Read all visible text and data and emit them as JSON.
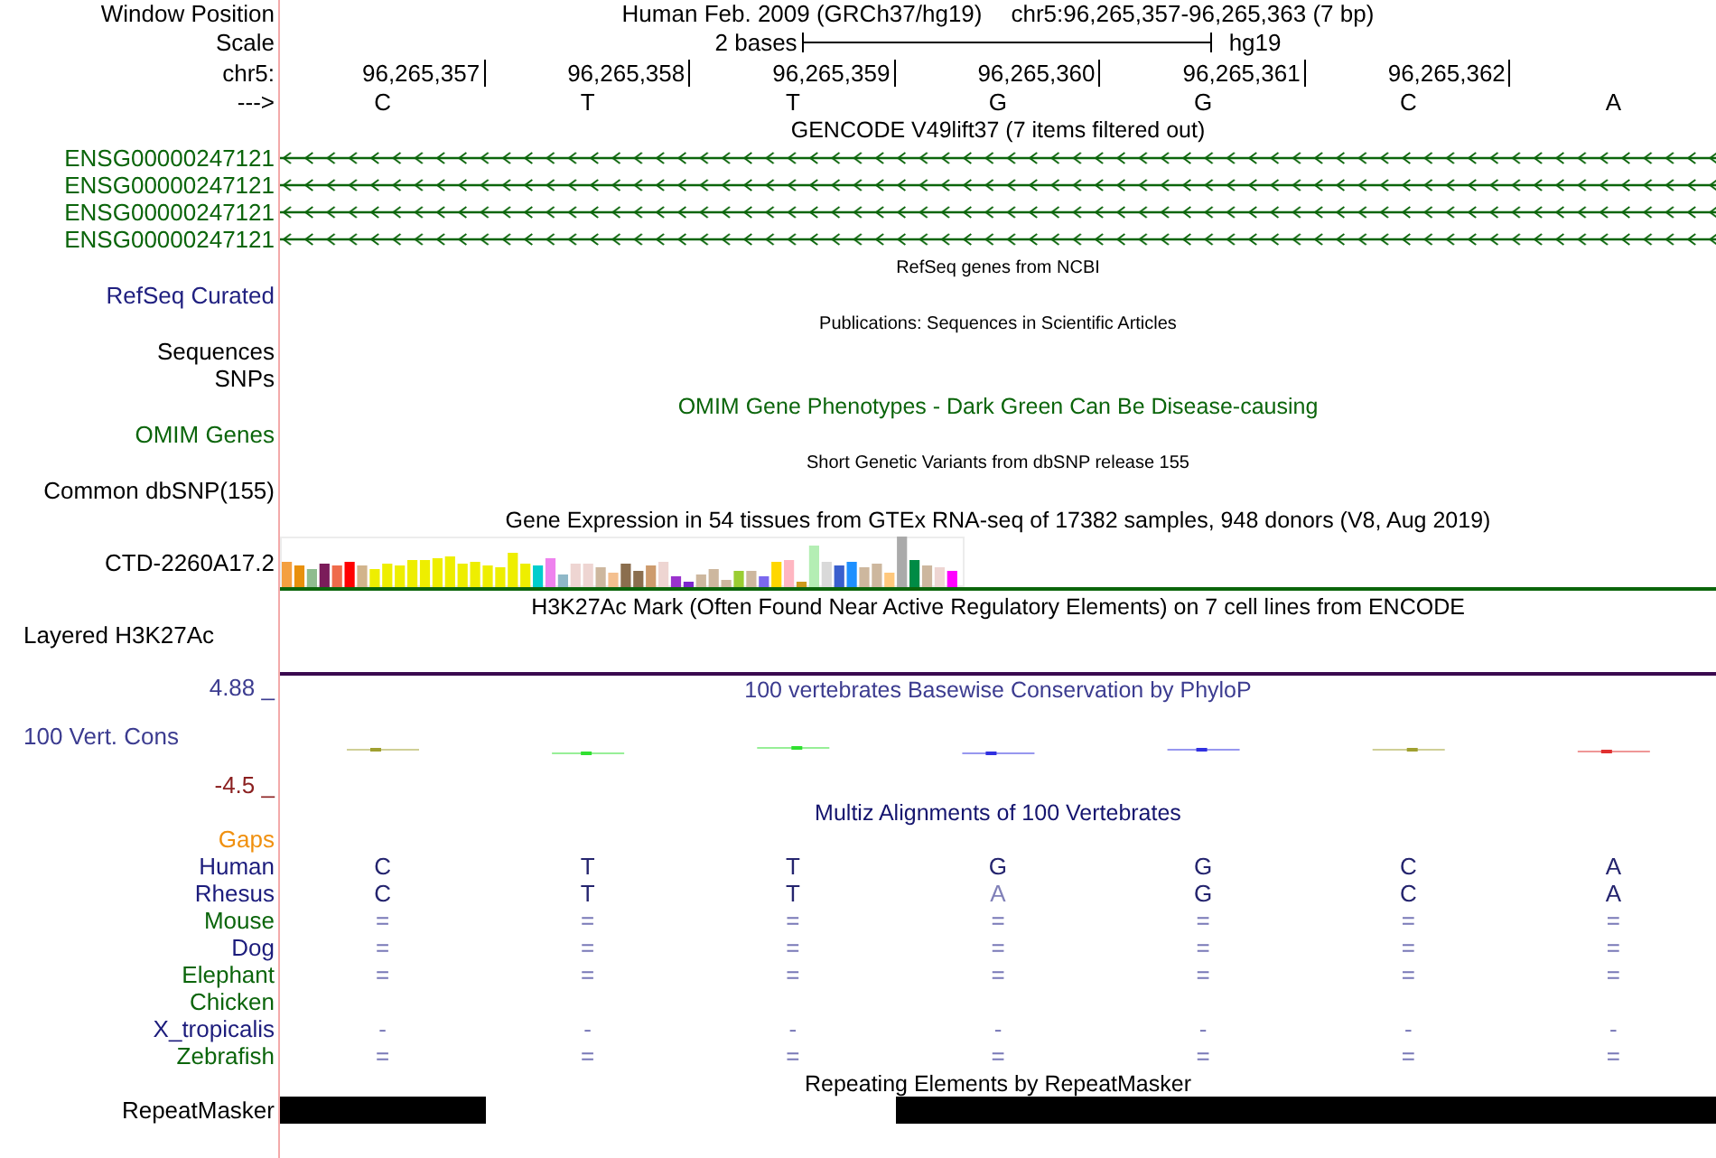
{
  "header": {
    "label": "Window Position",
    "assembly": "Human Feb. 2009 (GRCh37/hg19)",
    "position": "chr5:96,265,357-96,265,363 (7 bp)"
  },
  "scale": {
    "label": "Scale",
    "span": "2 bases",
    "assembly": "hg19"
  },
  "ruler": {
    "label": "chr5:",
    "positions": [
      "96,265,357",
      "96,265,358",
      "96,265,359",
      "96,265,360",
      "96,265,361",
      "96,265,362"
    ]
  },
  "sequence": {
    "label": "--->",
    "bases": [
      "C",
      "T",
      "T",
      "G",
      "G",
      "C",
      "A"
    ]
  },
  "tracks": [
    {
      "kind": "genes",
      "title": "GENCODE V49lift37 (7 items filtered out)",
      "color": "#000000",
      "items": [
        {
          "label": "ENSG00000247121"
        },
        {
          "label": "ENSG00000247121"
        },
        {
          "label": "ENSG00000247121"
        },
        {
          "label": "ENSG00000247121"
        }
      ]
    },
    {
      "kind": "dense",
      "title": "RefSeq genes from NCBI",
      "color": "#000000",
      "labels": [
        {
          "text": "RefSeq Curated",
          "color": "#202080"
        }
      ]
    },
    {
      "kind": "dense",
      "title": "Publications: Sequences in Scientific Articles",
      "color": "#000000",
      "labels": [
        {
          "text": "Sequences",
          "color": "#000000"
        },
        {
          "text": "SNPs",
          "color": "#000000"
        }
      ]
    },
    {
      "kind": "full",
      "title": "OMIM Gene Phenotypes - Dark Green Can Be Disease-causing",
      "color": "#0b650b",
      "labels": [
        {
          "text": "OMIM Genes",
          "color": "#0b650b"
        }
      ]
    },
    {
      "kind": "dense",
      "title": "Short Genetic Variants from dbSNP release 155",
      "color": "#000000",
      "labels": [
        {
          "text": "Common dbSNP(155)",
          "color": "#000000"
        }
      ]
    },
    {
      "kind": "barchart",
      "title": "Gene Expression in 54 tissues from GTEx RNA-seq of 17382 samples, 948 donors (V8, Aug 2019)",
      "color": "#000000",
      "label": "CTD-2260A17.2"
    },
    {
      "kind": "layered",
      "title": "H3K27Ac Mark (Often Found Near Active Regulatory Elements) on 7 cell lines from ENCODE",
      "color": "#000000",
      "label": "Layered H3K27Ac"
    },
    {
      "kind": "wiggle",
      "title": "100 vertebrates Basewise Conservation by PhyloP",
      "color": "#3c3c90",
      "label": "100 Vert. Cons",
      "max": "4.88 _",
      "min": "-4.5 _"
    },
    {
      "kind": "alignment",
      "title": "Multiz Alignments of 100 Vertebrates",
      "color": "#14146e",
      "rows": [
        {
          "label": "Gaps",
          "color": "#f0900f"
        },
        {
          "label": "Human",
          "color": "#1c1c7c",
          "bases": [
            {
              "b": "C",
              "match": true
            },
            {
              "b": "T",
              "match": true
            },
            {
              "b": "T",
              "match": true
            },
            {
              "b": "G",
              "match": true
            },
            {
              "b": "G",
              "match": true
            },
            {
              "b": "C",
              "match": true
            },
            {
              "b": "A",
              "match": true
            }
          ]
        },
        {
          "label": "Rhesus",
          "color": "#1c1c7c",
          "bases": [
            {
              "b": "C",
              "match": true
            },
            {
              "b": "T",
              "match": true
            },
            {
              "b": "T",
              "match": true
            },
            {
              "b": "A",
              "match": false
            },
            {
              "b": "G",
              "match": true
            },
            {
              "b": "C",
              "match": true
            },
            {
              "b": "A",
              "match": true
            }
          ]
        },
        {
          "label": "Mouse",
          "color": "#0b650b",
          "bases": [
            "=",
            "=",
            "=",
            "=",
            "=",
            "=",
            "="
          ]
        },
        {
          "label": "Dog",
          "color": "#1c1c7c",
          "bases": [
            "=",
            "=",
            "=",
            "=",
            "=",
            "=",
            "="
          ]
        },
        {
          "label": "Elephant",
          "color": "#0b650b",
          "bases": [
            "=",
            "=",
            "=",
            "=",
            "=",
            "=",
            "="
          ]
        },
        {
          "label": "Chicken",
          "color": "#0b650b"
        },
        {
          "label": "X_tropicalis",
          "color": "#1c1c7c",
          "bases": [
            "-",
            "-",
            "-",
            "-",
            "-",
            "-",
            "-"
          ]
        },
        {
          "label": "Zebrafish",
          "color": "#0b650b",
          "bases": [
            "=",
            "=",
            "=",
            "=",
            "=",
            "=",
            "="
          ]
        }
      ]
    },
    {
      "kind": "repeats",
      "title": "Repeating Elements by RepeatMasker",
      "color": "#000000",
      "label": "RepeatMasker",
      "covered": [
        true,
        false,
        false,
        true,
        true,
        true,
        true
      ]
    }
  ]
}
